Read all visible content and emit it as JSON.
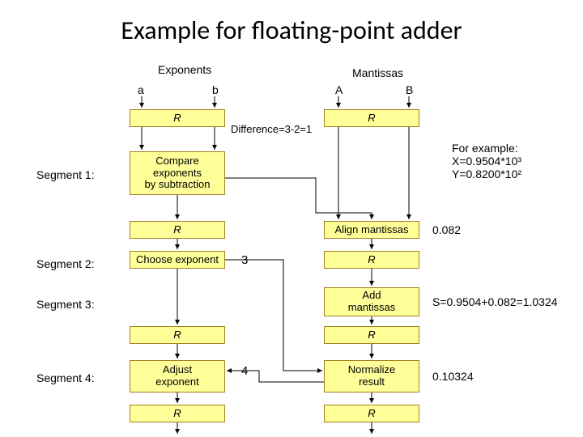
{
  "title": "Example for floating-point adder",
  "header": {
    "exponents": "Exponents",
    "mantissas": "Mantissas",
    "a": "a",
    "b": "b",
    "A": "A",
    "B": "B"
  },
  "segments": {
    "s1": "Segment 1:",
    "s2": "Segment 2:",
    "s3": "Segment 3:",
    "s4": "Segment 4:"
  },
  "boxes": {
    "R": "R",
    "compare": "Compare\nexponents\nby subtraction",
    "choose": "Choose exponent",
    "adjust": "Adjust\nexponent",
    "align": "Align mantissas",
    "add": "Add\nmantissas",
    "normalize": "Normalize\nresult"
  },
  "annot": {
    "diff": "Difference=3-2=1",
    "three": "3",
    "four": "4",
    "example": "For example:\nX=0.9504*10³\nY=0.8200*10²",
    "v082": "0.082",
    "sum": "S=0.9504+0.082=1.0324",
    "result": "0.10324"
  }
}
